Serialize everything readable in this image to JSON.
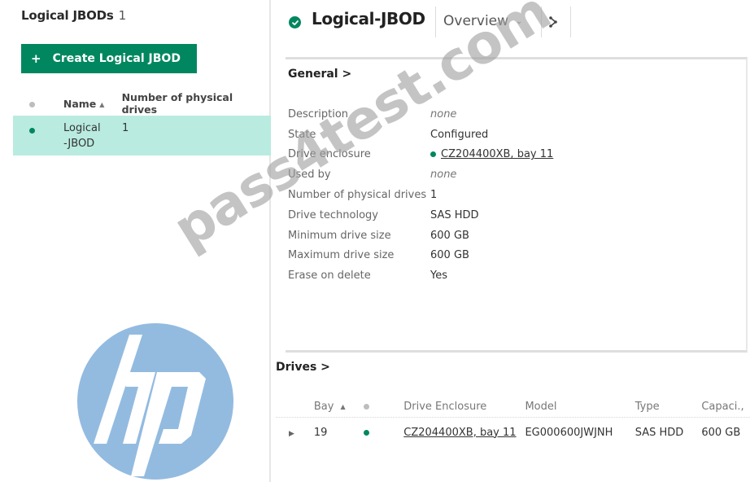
{
  "master": {
    "title": "Logical JBODs",
    "count": "1",
    "create_button": {
      "icon": "plus-icon",
      "glyph": "+",
      "label": "Create Logical JBOD"
    },
    "table": {
      "columns": [
        {
          "key": "status",
          "label": "",
          "icon": "status-dot-icon"
        },
        {
          "key": "name",
          "label": "Name",
          "sorted": "ascending",
          "sort_glyph": "▲"
        },
        {
          "key": "drives",
          "label": "Number of physical drives"
        }
      ],
      "rows": [
        {
          "status": "ok",
          "status_color": "#01875f",
          "name_line1": "Logical",
          "name_line2": "-JBOD",
          "drives": "1",
          "selected": true
        }
      ]
    }
  },
  "detail": {
    "status_icon": "check-circle-icon",
    "status_color": "#01875f",
    "title": "Logical-JBOD",
    "view_select": {
      "value": "Overview",
      "chevron": "⌄"
    },
    "actions_icon": "actions-icon",
    "general": {
      "title": "General >",
      "fields": [
        {
          "label": "Description",
          "value": "none",
          "style": "italic"
        },
        {
          "label": "State",
          "value": "Configured"
        },
        {
          "label": "Drive enclosure",
          "value": "CZ204400XB, bay 11",
          "style": "link",
          "status_color": "#01875f"
        },
        {
          "label": "Used by",
          "value": "none",
          "style": "italic"
        },
        {
          "label": "Number of physical drives",
          "value": "1"
        },
        {
          "label": "Drive technology",
          "value": "SAS HDD"
        },
        {
          "label": "Minimum drive size",
          "value": "600 GB"
        },
        {
          "label": "Maximum drive size",
          "value": "600 GB"
        },
        {
          "label": "Erase on delete",
          "value": "Yes"
        }
      ]
    },
    "drives": {
      "title": "Drives >",
      "columns": [
        {
          "key": "expand",
          "label": ""
        },
        {
          "key": "bay",
          "label": "Bay",
          "sorted": "ascending",
          "sort_glyph": "▲"
        },
        {
          "key": "status",
          "label": "",
          "icon": "status-dot-icon"
        },
        {
          "key": "enclosure",
          "label": "Drive Enclosure"
        },
        {
          "key": "model",
          "label": "Model"
        },
        {
          "key": "type",
          "label": "Type"
        },
        {
          "key": "capacity",
          "label": "Capaci.,"
        }
      ],
      "rows": [
        {
          "expand_glyph": "▶",
          "bay": "19",
          "status_color": "#01875f",
          "enclosure": "CZ204400XB, bay 11",
          "model": "EG000600JWJNH",
          "type": "SAS HDD",
          "capacity": "600 GB"
        }
      ]
    }
  },
  "overlays": {
    "logo": {
      "text": "hp",
      "color": "#93bbe0"
    },
    "watermark": "pass4test.com"
  },
  "colors": {
    "accent": "#01875f",
    "selected_row": "#b9ebe0"
  }
}
